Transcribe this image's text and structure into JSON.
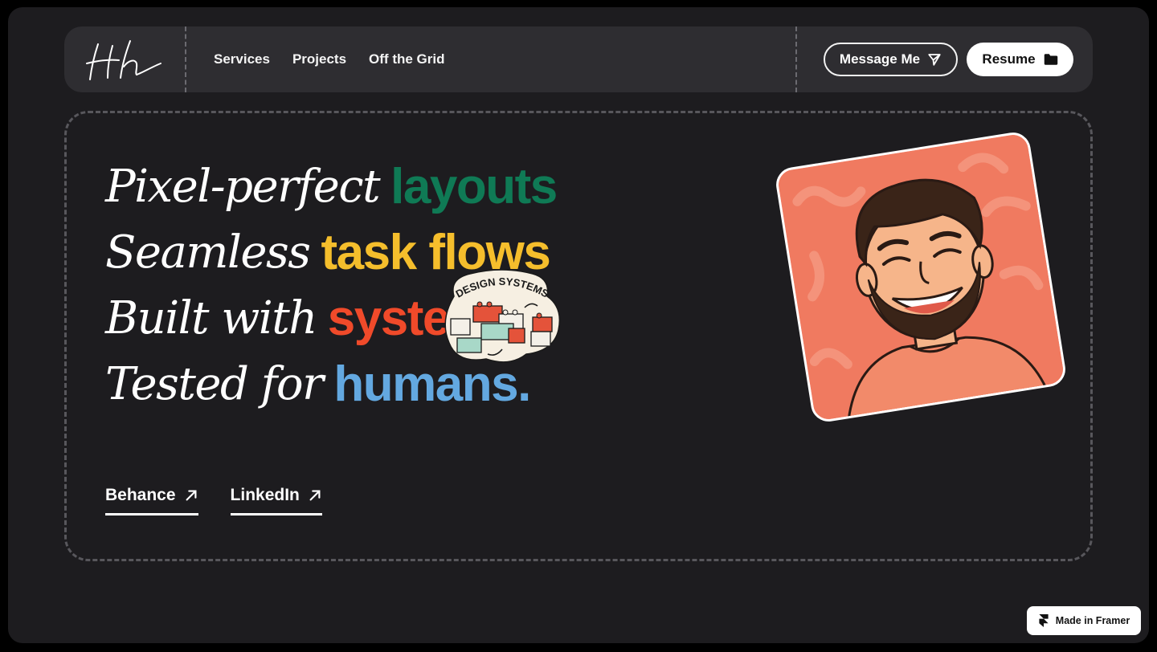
{
  "nav": {
    "logo_text": "Hh",
    "links": [
      "Services",
      "Projects",
      "Off the Grid"
    ],
    "message_label": "Message Me",
    "resume_label": "Resume"
  },
  "hero": {
    "lines": [
      {
        "script": "Pixel-perfect",
        "bold": "layouts",
        "color": "#0f7a55"
      },
      {
        "script": "Seamless",
        "bold": "task flows",
        "color": "#f5be2c"
      },
      {
        "script": "Built with",
        "bold": "systems",
        "color": "#f04a2a"
      },
      {
        "script": "Tested for",
        "bold": "humans.",
        "color": "#63a8e0"
      }
    ],
    "sticker_text": "DESIGN SYSTEMS",
    "links": [
      {
        "label": "Behance"
      },
      {
        "label": "LinkedIn"
      }
    ]
  },
  "icons": {
    "message": "send-icon",
    "resume": "folder-icon",
    "link": "arrow-up-right-icon",
    "framer": "framer-logo-icon"
  },
  "badge": {
    "label": "Made in Framer"
  },
  "colors": {
    "background": "#1d1c1f",
    "nav": "#2e2d31",
    "portrait_bg": "#f07a60"
  }
}
